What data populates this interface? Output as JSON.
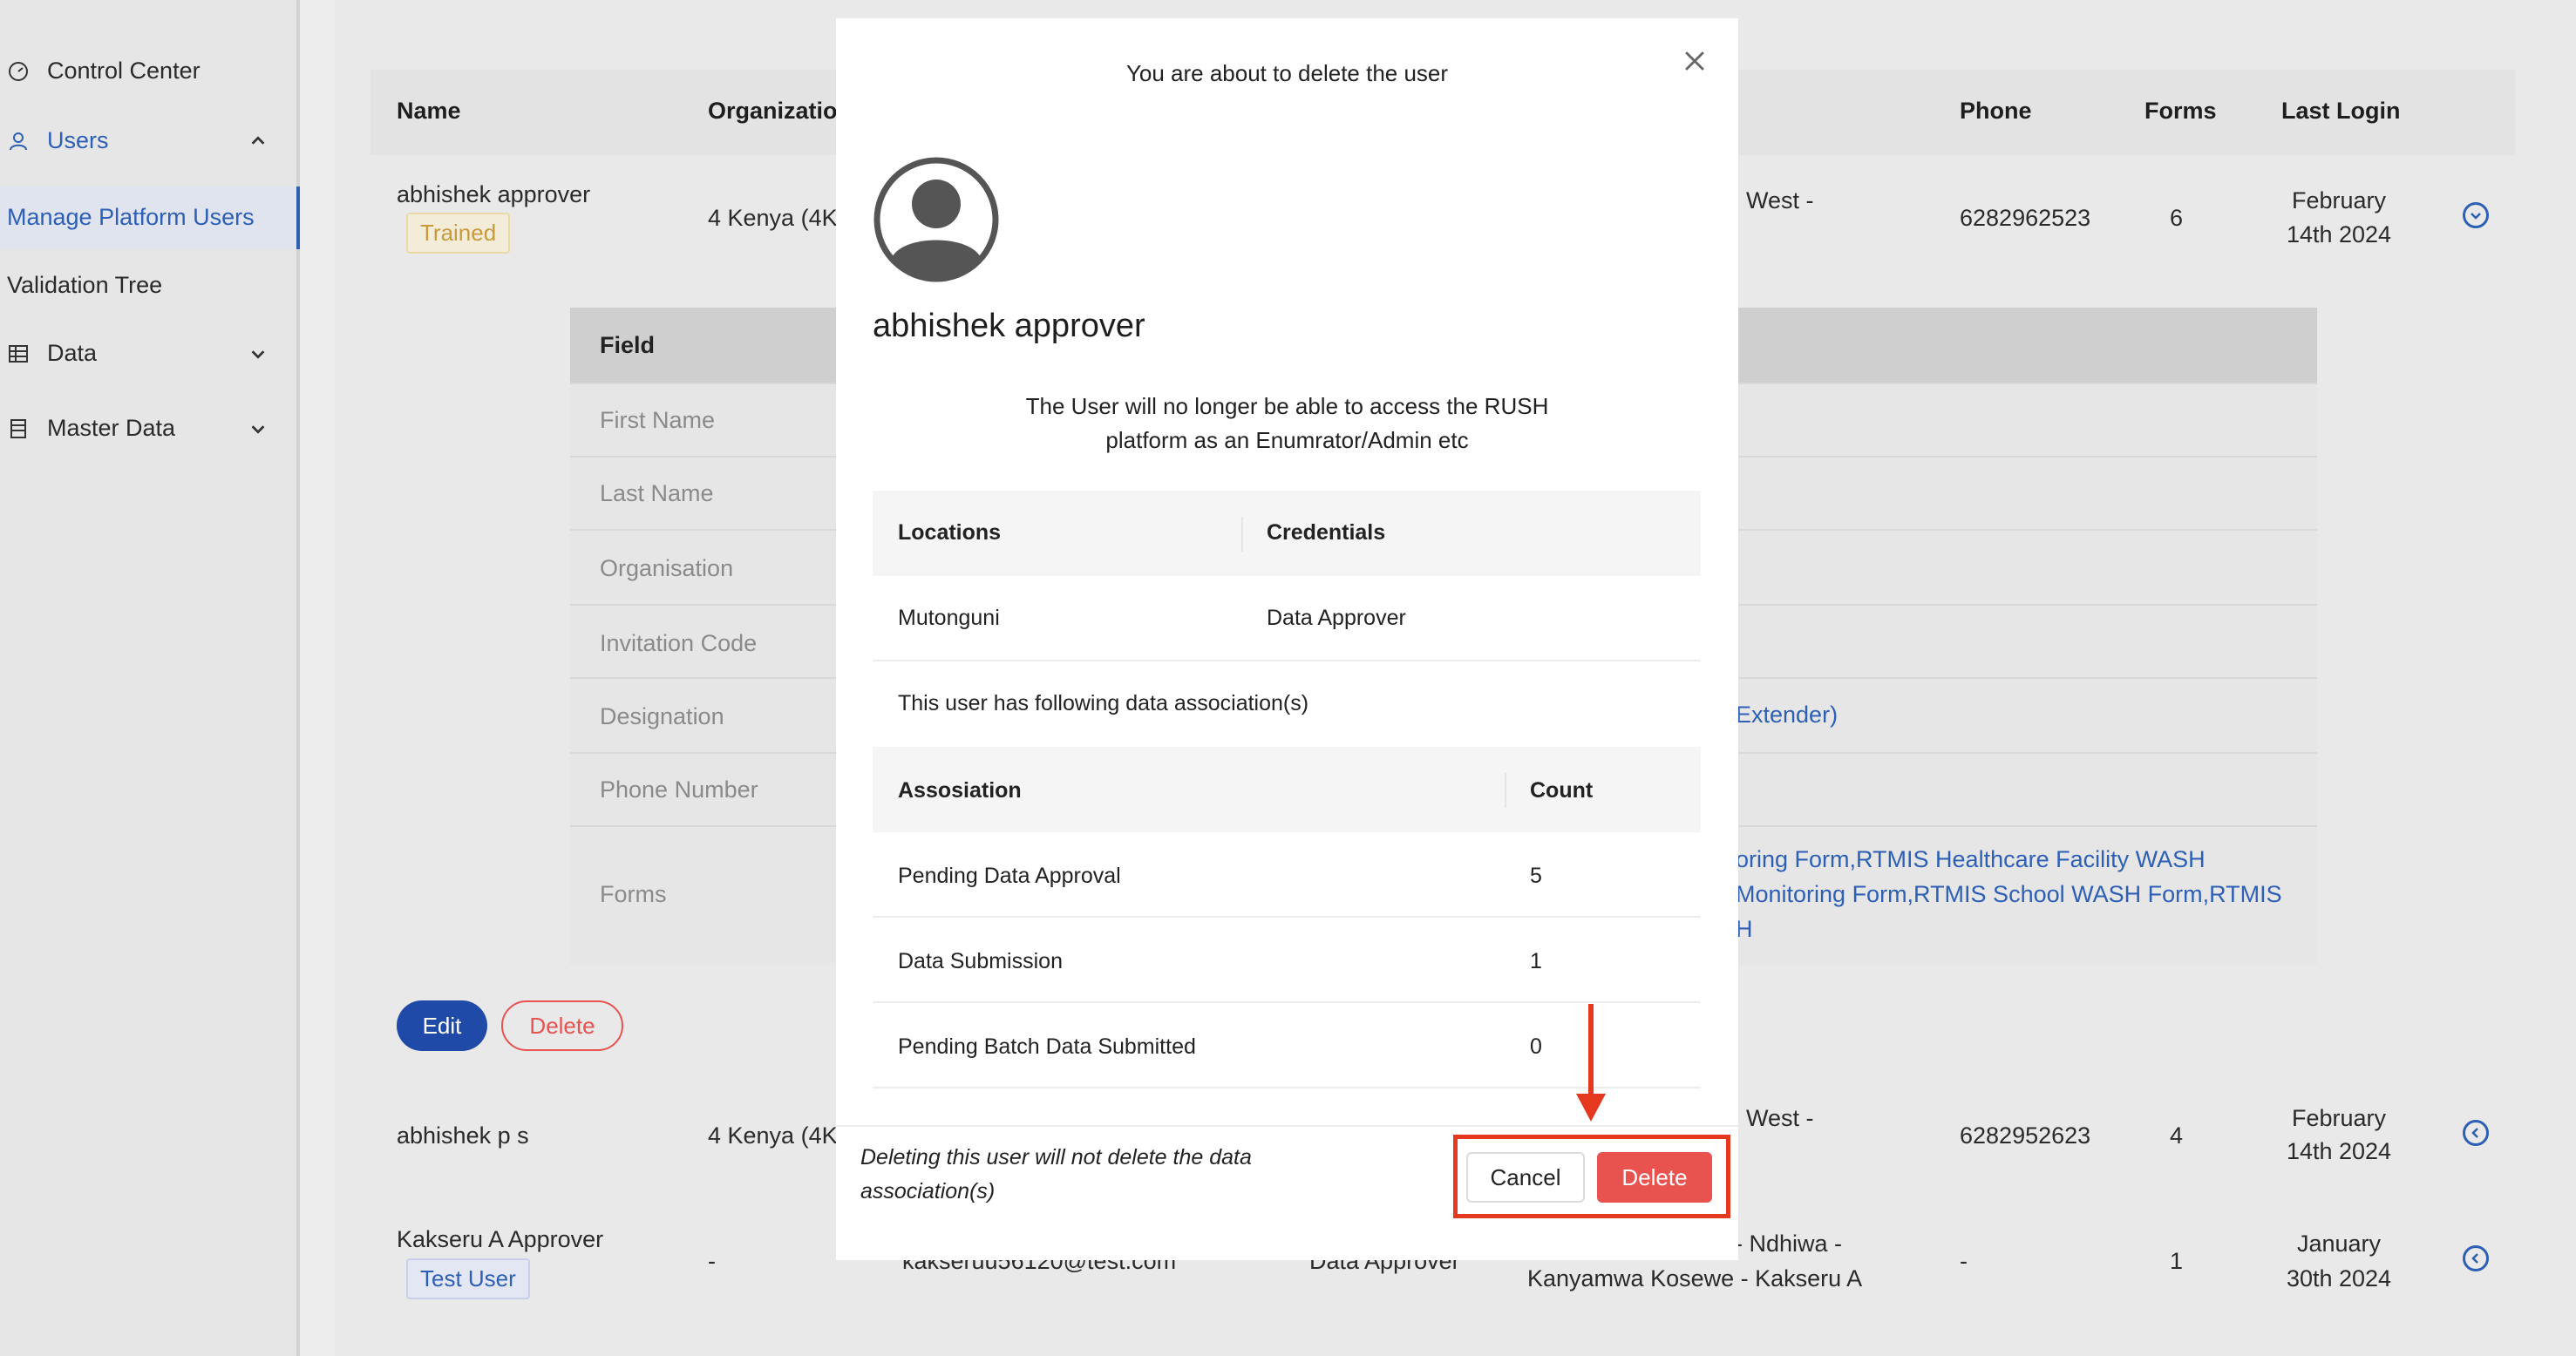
{
  "sidebar": {
    "items": [
      {
        "label": "Control Center",
        "icon": "dashboard-icon"
      },
      {
        "label": "Users",
        "icon": "user-icon"
      },
      {
        "label": "Manage Platform Users"
      },
      {
        "label": "Validation Tree"
      },
      {
        "label": "Data",
        "icon": "table-icon"
      },
      {
        "label": "Master Data",
        "icon": "database-icon"
      }
    ]
  },
  "table": {
    "headers": [
      "Name",
      "Organizatio",
      "Phone",
      "Forms",
      "Last Login"
    ],
    "rows": [
      {
        "name": "abhishek approver",
        "tag": "Trained",
        "org": "4 Kenya (4K",
        "location": "West -",
        "phone": "6282962523",
        "forms": "6",
        "last_login": [
          "February",
          "14th 2024"
        ]
      },
      {
        "name": "abhishek p s",
        "org": "4 Kenya (4K",
        "location": "West -",
        "phone": "6282952623",
        "forms": "4",
        "last_login": [
          "February",
          "14th 2024"
        ]
      },
      {
        "name": "Kakseru A Approver",
        "tag": "Test User",
        "org": "-",
        "email": "kakseruu56120@test.com",
        "role": "Data Approver",
        "location": [
          "- Ndhiwa -",
          "Kanyamwa Kosewe - Kakseru A"
        ],
        "phone": "-",
        "forms": "1",
        "last_login": [
          "January",
          "30th 2024"
        ]
      }
    ]
  },
  "detail": {
    "header": "Field",
    "fields": [
      "First Name",
      "Last Name",
      "Organisation",
      "Invitation Code",
      "Designation",
      "Phone Number",
      "Forms"
    ],
    "designation_fragment": "Extender)",
    "forms_fragment": [
      "oring Form,RTMIS Healthcare Facility WASH",
      "Monitoring Form,RTMIS School WASH Form,RTMIS",
      "H"
    ],
    "edit_label": "Edit",
    "delete_label": "Delete"
  },
  "modal": {
    "title": "You are about to delete the user",
    "user_name": "abhishek approver",
    "warning_line1": "The User will no longer be able to access the RUSH",
    "warning_line2": "platform as an Enumrator/Admin etc",
    "loc_table": {
      "headers": [
        "Locations",
        "Credentials"
      ],
      "row": [
        "Mutonguni",
        "Data Approver"
      ]
    },
    "assoc_intro": "This user has following data association(s)",
    "assoc_table": {
      "headers": [
        "Assosiation",
        "Count"
      ],
      "rows": [
        [
          "Pending Data Approval",
          "5"
        ],
        [
          "Data Submission",
          "1"
        ],
        [
          "Pending Batch Data Submitted",
          "0"
        ]
      ]
    },
    "footer_note_line1": "Deleting this user will not delete the data",
    "footer_note_line2": "association(s)",
    "cancel_label": "Cancel",
    "delete_label": "Delete"
  },
  "colors": {
    "accent": "#2d5fb5",
    "danger": "#e8524f",
    "annotation": "#e5391f",
    "trained": "#c79a3a",
    "testuser": "#2d5fb5"
  }
}
